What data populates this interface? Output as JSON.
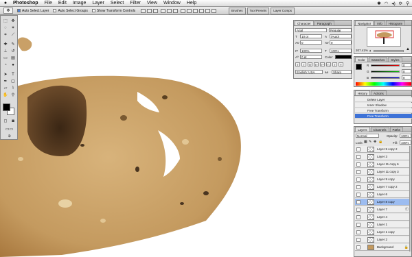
{
  "menubar": {
    "apple": "",
    "app": "Photoshop",
    "items": [
      "File",
      "Edit",
      "Image",
      "Layer",
      "Select",
      "Filter",
      "View",
      "Window",
      "Help"
    ],
    "clock": "",
    "volume_icon": "speaker-icon",
    "bluetooth_icon": "bluetooth-icon",
    "wifi_icon": "wifi-icon"
  },
  "options_bar": {
    "auto_select_layer": "Auto Select Layer",
    "auto_select_groups": "Auto Select Groups",
    "show_transform_controls": "Show Transform Controls"
  },
  "palette_well": {
    "tabs": [
      "Brushes",
      "Tool Presets",
      "Layer Comps"
    ]
  },
  "character": {
    "tabs": [
      "Character",
      "Paragraph"
    ],
    "font_family": "Arial",
    "font_style": "Regular",
    "font_size": "10 pt",
    "leading": "(Auto)",
    "kerning": "0",
    "tracking": "0",
    "vertical_scale": "100%",
    "horizontal_scale": "100%",
    "baseline_shift": "0 pt",
    "color_label": "Color:",
    "language": "English: USA",
    "anti_alias": "Sharp"
  },
  "navigator": {
    "tabs": [
      "Navigator",
      "Info",
      "Histogram"
    ],
    "zoom": "207.41%"
  },
  "color_panel": {
    "tabs": [
      "Color",
      "Swatches",
      "Styles"
    ],
    "r_label": "R",
    "g_label": "G",
    "b_label": "B",
    "r": "0",
    "g": "0",
    "b": "0"
  },
  "history": {
    "tabs": [
      "History",
      "Actions"
    ],
    "items": [
      "Delete Layer",
      "Inner Shadow",
      "Free Transform",
      "Free Transform"
    ],
    "selected_index": 3
  },
  "layers": {
    "tabs": [
      "Layers",
      "Channels",
      "Paths"
    ],
    "blend_mode": "Normal",
    "opacity_label": "Opacity:",
    "opacity": "100%",
    "lock_label": "Lock:",
    "fill_label": "Fill:",
    "fill": "100%",
    "items": [
      {
        "name": "Layer 5 copy 2",
        "fx": ""
      },
      {
        "name": "Layer 3",
        "fx": ""
      },
      {
        "name": "Layer 11 copy 6",
        "fx": ""
      },
      {
        "name": "Layer 11 copy 3",
        "fx": ""
      },
      {
        "name": "Layer 9 copy",
        "fx": ""
      },
      {
        "name": "Layer 7 copy 2",
        "fx": ""
      },
      {
        "name": "Layer 6",
        "fx": ""
      },
      {
        "name": "Layer 8 copy",
        "fx": ""
      },
      {
        "name": "Layer 7",
        "fx": "ⓕ"
      },
      {
        "name": "Layer 4",
        "fx": ""
      },
      {
        "name": "Layer 1",
        "fx": ""
      },
      {
        "name": "Layer 1 copy",
        "fx": ""
      },
      {
        "name": "Layer 2",
        "fx": ""
      },
      {
        "name": "Background",
        "fx": "🔒"
      }
    ],
    "selected_index": 7
  },
  "colors": {
    "bread": "#cfa56a",
    "crust": "#b5844b",
    "hole": "#4a3520",
    "accent": "#3d72d7"
  }
}
